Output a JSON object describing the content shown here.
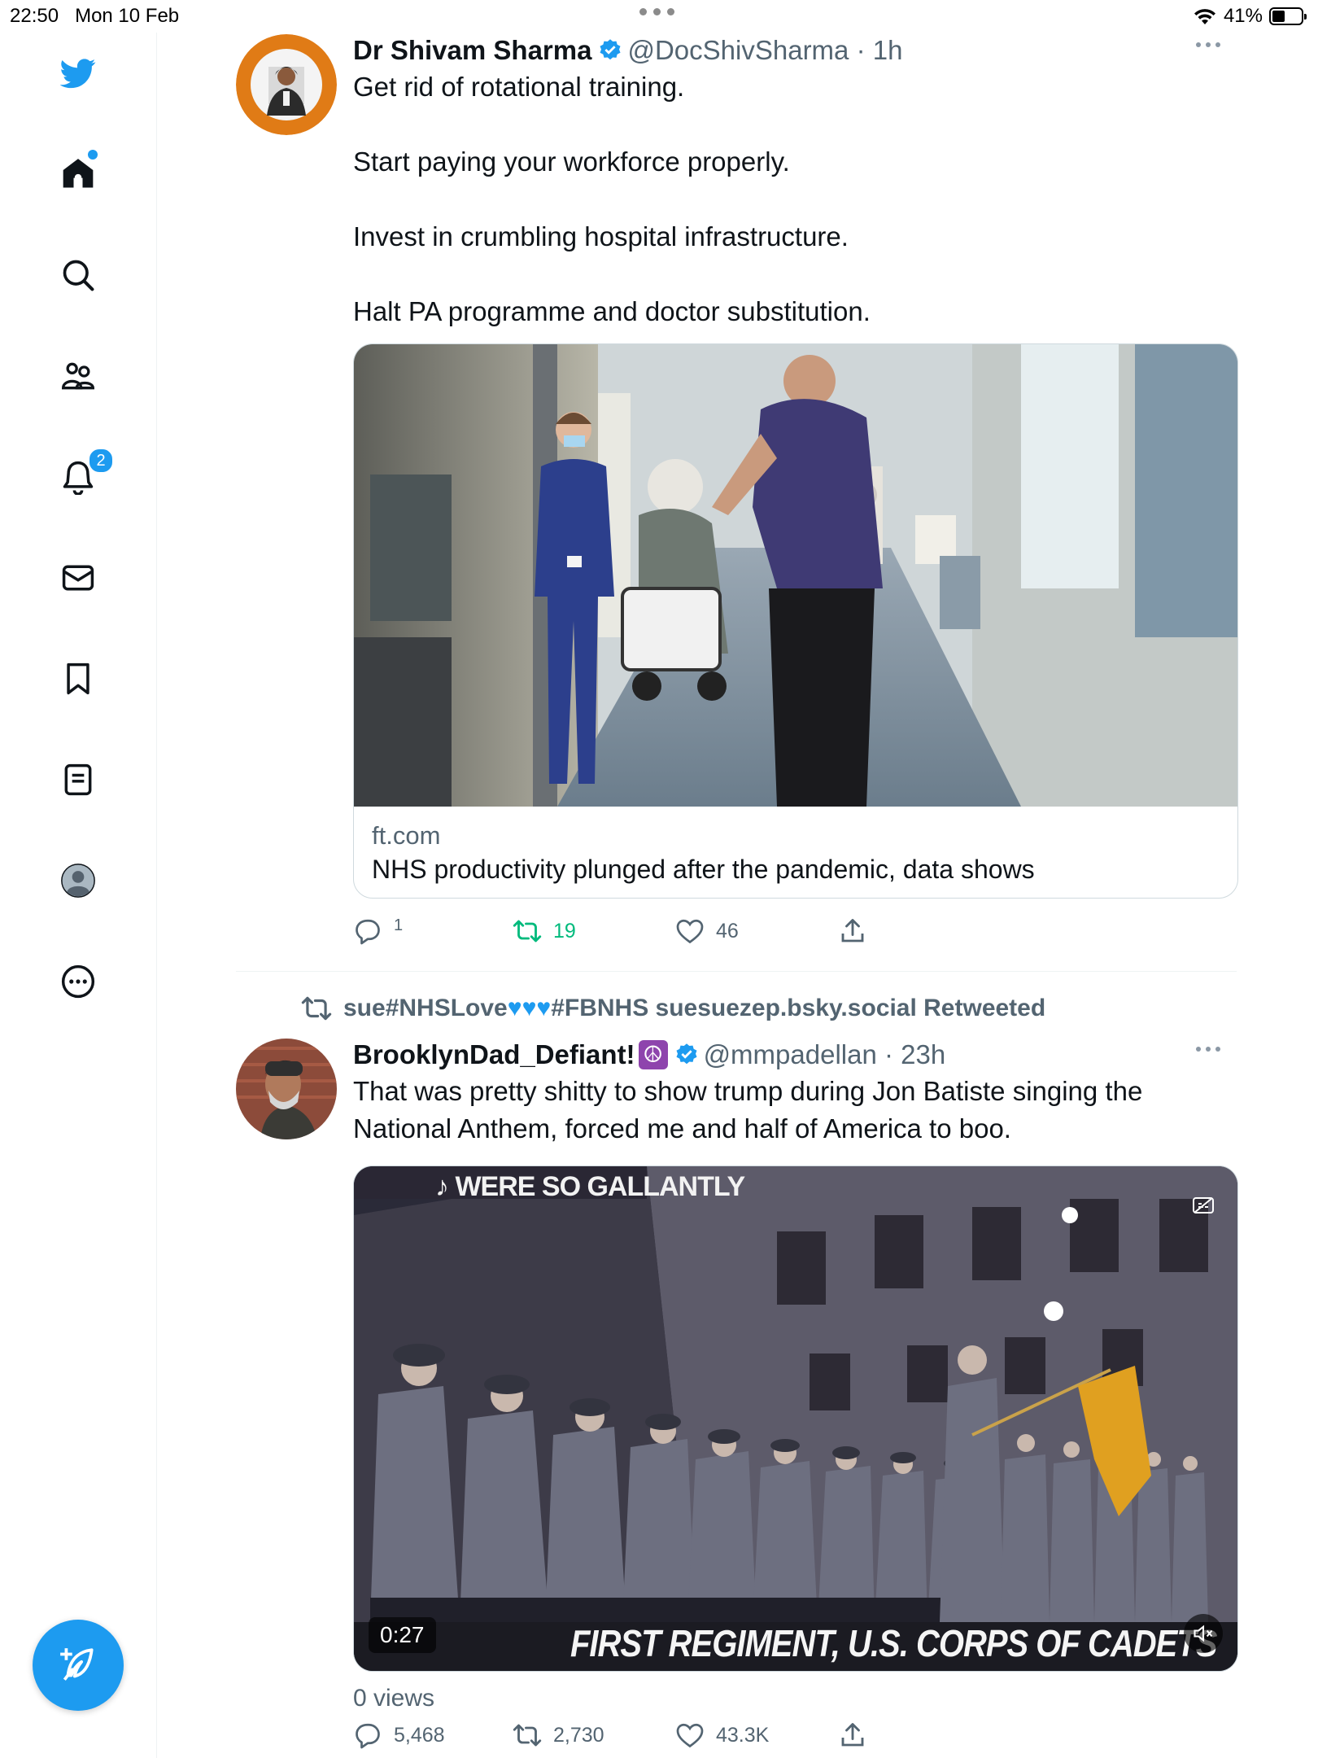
{
  "status_bar": {
    "time": "22:50",
    "date": "Mon 10 Feb",
    "battery": "41%"
  },
  "sidebar": {
    "items": [
      {
        "name": "twitter-logo"
      },
      {
        "name": "home"
      },
      {
        "name": "explore"
      },
      {
        "name": "communities"
      },
      {
        "name": "notifications",
        "badge": "2"
      },
      {
        "name": "messages"
      },
      {
        "name": "bookmarks"
      },
      {
        "name": "lists"
      },
      {
        "name": "profile"
      },
      {
        "name": "more"
      }
    ]
  },
  "tweets": [
    {
      "name": "Dr Shivam Sharma",
      "handle": "@DocShivSharma",
      "time": "1h",
      "text": "Get rid of rotational training.\n\nStart paying your workforce properly.\n\nInvest in crumbling hospital infrastructure.\n\nHalt PA programme and doctor substitution.",
      "card": {
        "domain": "ft.com",
        "title": "NHS productivity plunged after the pandemic, data shows"
      },
      "stats": {
        "replies": "1",
        "retweets": "19",
        "likes": "46"
      }
    },
    {
      "retweeted_by_prefix": "sue#NHSLove",
      "retweeted_by_suffix": "#FBNHS suesuezep.bsky.social Retweeted",
      "name": "BrooklynDad_Defiant!",
      "handle": "@mmpadellan",
      "time": "23h",
      "text": "That was pretty shitty to show trump during Jon Batiste singing the National Anthem, forced me and half of America to boo.",
      "video": {
        "duration": "0:27",
        "caption_top": "♪ WERE SO GALLANTLY",
        "caption_bottom": "FIRST REGIMENT, U.S. CORPS OF CADETS"
      },
      "views": "0 views",
      "stats": {
        "replies": "5,468",
        "retweets": "2,730",
        "likes": "43.3K"
      }
    }
  ],
  "colors": {
    "accent": "#1d9bf0",
    "retweet": "#00ba7c",
    "muted": "#536471"
  }
}
